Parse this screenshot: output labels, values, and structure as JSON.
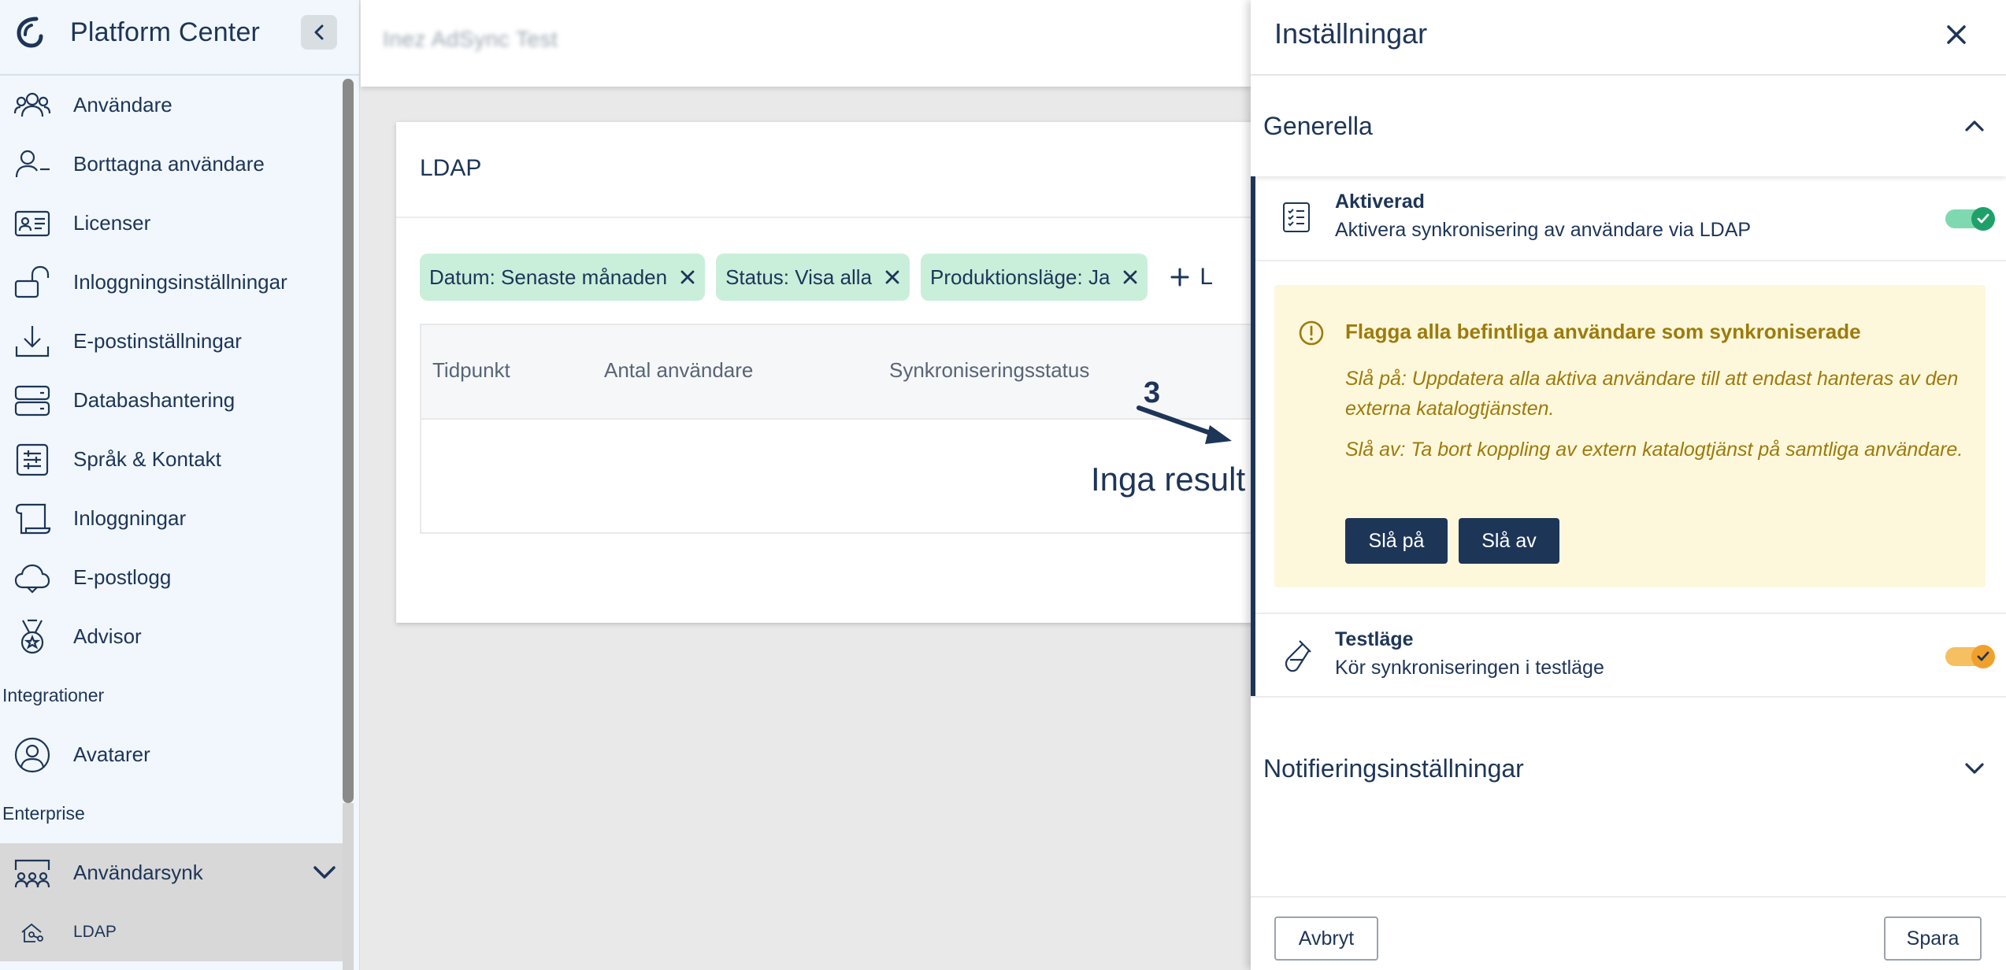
{
  "app": {
    "title": "Platform Center"
  },
  "sidebar": {
    "items": [
      {
        "label": "Användare",
        "icon": "users-icon"
      },
      {
        "label": "Borttagna användare",
        "icon": "user-minus-icon"
      },
      {
        "label": "Licenser",
        "icon": "id-card-icon"
      },
      {
        "label": "Inloggningsinställningar",
        "icon": "unlock-icon"
      },
      {
        "label": "E-postinställningar",
        "icon": "download-tray-icon"
      },
      {
        "label": "Databashantering",
        "icon": "server-icon"
      },
      {
        "label": "Språk & Kontakt",
        "icon": "sliders-icon"
      },
      {
        "label": "Inloggningar",
        "icon": "scroll-icon"
      },
      {
        "label": "E-postlogg",
        "icon": "cloud-icon"
      },
      {
        "label": "Advisor",
        "icon": "medal-icon"
      }
    ],
    "section_integrations": "Integrationer",
    "integrations": [
      {
        "label": "Avatarer",
        "icon": "user-circle-icon"
      }
    ],
    "section_enterprise": "Enterprise",
    "enterprise": [
      {
        "label": "Användarsynk",
        "icon": "people-group-icon"
      },
      {
        "label": "LDAP",
        "icon": "home-network-icon"
      }
    ]
  },
  "topbar": {
    "title": "Inez AdSync Test"
  },
  "card": {
    "title": "LDAP",
    "filters": [
      {
        "label": "Datum: Senaste månaden"
      },
      {
        "label": "Status: Visa alla"
      },
      {
        "label": "Produktionsläge: Ja"
      }
    ],
    "add_filter_label": "L",
    "columns": [
      "Tidpunkt",
      "Antal användare",
      "Synkroniseringsstatus"
    ],
    "empty_message": "Inga result"
  },
  "panel": {
    "title": "Inställningar",
    "general": {
      "title": "Generella",
      "activated": {
        "title": "Aktiverad",
        "desc": "Aktivera synkronisering av användare via LDAP",
        "on": true
      },
      "warning": {
        "title": "Flagga alla befintliga användare som synkroniserade",
        "on_text": "Slå på: Uppdatera alla aktiva användare till att endast hanteras av den externa katalogtjänsten.",
        "off_text": "Slå av: Ta bort koppling av extern katalogtjänst på samtliga användare.",
        "btn_on": "Slå på",
        "btn_off": "Slå av"
      },
      "testmode": {
        "title": "Testläge",
        "desc": "Kör synkroniseringen i testläge",
        "on": true
      }
    },
    "notifications": {
      "title": "Notifieringsinställningar"
    },
    "footer": {
      "cancel": "Avbryt",
      "save": "Spara"
    }
  },
  "annotation": {
    "number": "3"
  },
  "colors": {
    "primary": "#1d3557",
    "chip": "#c9efdb",
    "toggle_green": "#1fa06a",
    "toggle_orange": "#f0a12d",
    "warning_bg": "#fdf8dc",
    "warning_text": "#9e7a0b"
  }
}
